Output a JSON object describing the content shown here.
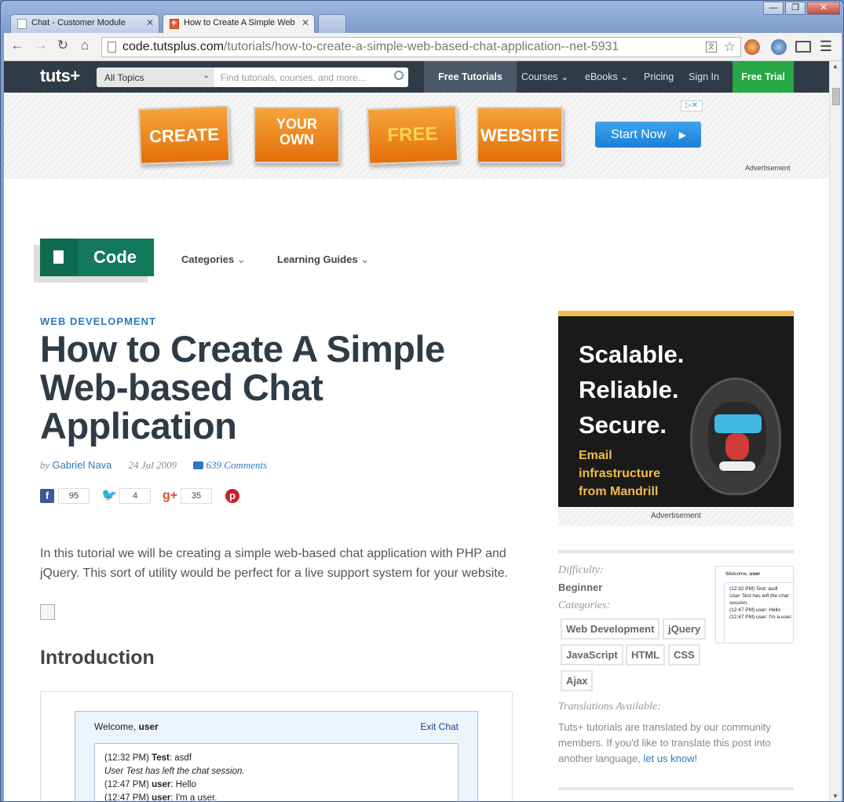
{
  "browser": {
    "tabs": [
      {
        "label": "Chat - Customer Module"
      },
      {
        "label": "How to Create A Simple Web"
      }
    ],
    "url_domain": "code.tutsplus.com",
    "url_path": "/tutorials/how-to-create-a-simple-web-based-chat-application--net-5931"
  },
  "nav": {
    "logo": "tuts+",
    "topics": "All Topics",
    "search_placeholder": "Find tutorials, courses, and more...",
    "items": [
      "Free Tutorials",
      "Courses",
      "eBooks",
      "Pricing",
      "Sign In",
      "Free Trial"
    ]
  },
  "banner": {
    "words": [
      "CREATE",
      "YOUR",
      "OWN",
      "FREE",
      "WEBSITE"
    ],
    "button": "Start Now",
    "label": "Advertisement"
  },
  "section": {
    "name": "Code",
    "categories": "Categories",
    "guides": "Learning Guides"
  },
  "article": {
    "category": "WEB DEVELOPMENT",
    "title": "How to Create A Simple Web-based Chat Application",
    "by": "by",
    "author": "Gabriel Nava",
    "date": "24 Jul 2009",
    "comments": "639 Comments",
    "social": {
      "facebook": "95",
      "twitter": "4",
      "googleplus": "35"
    },
    "intro": "In this tutorial we will be creating a simple web-based chat application with PHP and jQuery. This sort of utility would be perfect for a live support system for your website.",
    "h2": "Introduction",
    "chat": {
      "welcome": "Welcome,",
      "user": "user",
      "exit": "Exit Chat",
      "lines": [
        {
          "t": "(12:32 PM)",
          "n": "Test",
          "m": ": asdf"
        },
        {
          "sys": "User Test has left the chat session."
        },
        {
          "t": "(12:47 PM)",
          "n": "user",
          "m": ": Hello"
        },
        {
          "t": "(12:47 PM)",
          "n": "user",
          "m": ": I'm a user."
        }
      ]
    }
  },
  "ad": {
    "lines": [
      "Scalable.",
      "Reliable.",
      "Secure."
    ],
    "sub": [
      "Email",
      "infrastructure",
      "from Mandrill"
    ],
    "label": "Advertisement"
  },
  "sidebar": {
    "difficulty_label": "Difficulty:",
    "difficulty": "Beginner",
    "categories_label": "Categories:",
    "tags": [
      "Web Development",
      "jQuery",
      "JavaScript",
      "HTML",
      "CSS",
      "Ajax"
    ],
    "translations_label": "Translations Available:",
    "translations_text": "Tuts+ tutorials are translated by our community members. If you'd like to translate this post into another language,",
    "translations_link": "let us know!",
    "thumb_welcome": "Welcome,",
    "thumb_user": "user",
    "thumb_lines": [
      "(12:32 PM) Test: asdf",
      "User Test has left the chat session.",
      "(12:47 PM) user: Hello",
      "(12:47 PM) user: I'm a user."
    ]
  },
  "colors": {
    "nav": "#2f3b47",
    "accent": "#2c79bf",
    "code_green": "#13795b",
    "trial_green": "#28a745",
    "ad_yellow": "#f4bb4a"
  }
}
